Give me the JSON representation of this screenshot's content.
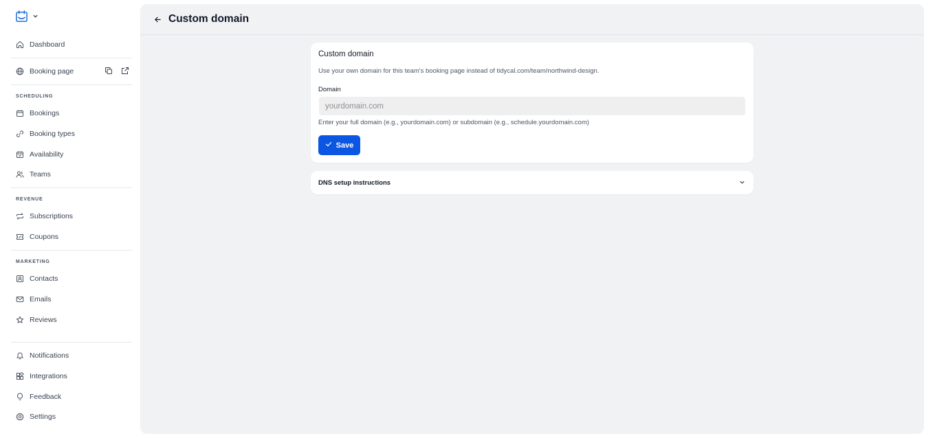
{
  "sidebar": {
    "dashboard": "Dashboard",
    "booking_page": "Booking page",
    "sections": {
      "scheduling": "SCHEDULING",
      "revenue": "REVENUE",
      "marketing": "MARKETING"
    },
    "scheduling_items": [
      "Bookings",
      "Booking types",
      "Availability",
      "Teams"
    ],
    "revenue_items": [
      "Subscriptions",
      "Coupons"
    ],
    "marketing_items": [
      "Contacts",
      "Emails",
      "Reviews"
    ],
    "bottom_items": [
      "Notifications",
      "Integrations",
      "Feedback",
      "Settings"
    ]
  },
  "header": {
    "title": "Custom domain"
  },
  "custom_domain_card": {
    "title": "Custom domain",
    "description": "Use your own domain for this team's booking page instead of tidycal.com/team/northwind-design.",
    "field_label": "Domain",
    "placeholder": "yourdomain.com",
    "value": "",
    "helper": "Enter your full domain (e.g., yourdomain.com) or subdomain (e.g., schedule.yourdomain.com)",
    "save_label": "Save"
  },
  "dns_card": {
    "label": "DNS setup instructions"
  },
  "colors": {
    "accent": "#0b57e3",
    "main_bg": "#f1f2f4",
    "logo": "#1f6fd6"
  }
}
